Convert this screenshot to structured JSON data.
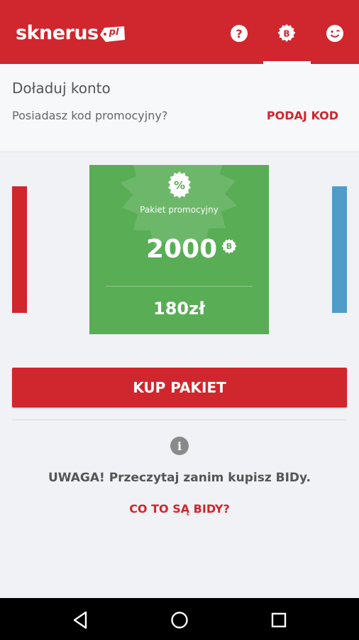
{
  "header": {
    "logo_text": "sknerus",
    "logo_tag": "pl",
    "icons": [
      "help-icon",
      "bid-coin-icon",
      "profile-smile-icon"
    ],
    "accent_color": "#d0262d"
  },
  "topup": {
    "title": "Doładuj konto",
    "promo_question": "Posiadasz kod promocyjny?",
    "promo_link": "PODAJ KOD"
  },
  "package": {
    "name": "Pakiet promocyjny",
    "amount": "2000",
    "coin_letter": "B",
    "price": "180zł",
    "color": "#58ad55",
    "badge_symbol": "%"
  },
  "side_cards": {
    "left_color": "#d0262d",
    "right_color": "#4f9ccb"
  },
  "actions": {
    "buy_label": "KUP PAKIET"
  },
  "info": {
    "icon_letter": "i",
    "warning": "UWAGA! Przeczytaj zanim kupisz BIDy.",
    "link": "CO TO SĄ BIDY?"
  },
  "nav": {
    "icons": [
      "back-icon",
      "home-icon",
      "recents-icon"
    ]
  }
}
